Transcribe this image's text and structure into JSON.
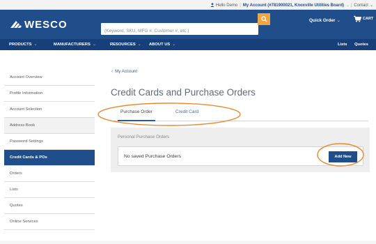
{
  "utility_bar": {
    "hello": "Hello Demo",
    "account": "My Account (#781900021, Knoxville Utilities Board)",
    "contact": "Contact"
  },
  "header": {
    "logo_text": "WESCO",
    "search_placeholder": "(Keyword, SKU, MFG #, Customer #, etc.)",
    "quick_order": "Quick Order",
    "cart": "CART"
  },
  "nav": {
    "products": "PRODUCTS",
    "manufacturers": "MANUFACTURERS",
    "resources": "RESOURCES",
    "about": "ABOUT US",
    "lists": "Lists",
    "quotes": "Quotes"
  },
  "sidebar": {
    "items": [
      {
        "label": "Account Overview"
      },
      {
        "label": "Profile Information"
      },
      {
        "label": "Account Selection"
      },
      {
        "label": "Address Book"
      },
      {
        "label": "Password Settings"
      },
      {
        "label": "Credit Cards & POs"
      },
      {
        "label": "Orders"
      },
      {
        "label": "Lists"
      },
      {
        "label": "Quotes"
      },
      {
        "label": "Online Services"
      }
    ]
  },
  "main": {
    "back_link": "My Account",
    "title": "Credit Cards and Purchase Orders",
    "tabs": [
      {
        "label": "Purchase Order"
      },
      {
        "label": "Credit Card"
      }
    ],
    "panel_title": "Personal Purchase Orders",
    "empty_text": "No saved Purchase Orders",
    "add_button": "Add New"
  },
  "colors": {
    "brand_blue": "#1f4e8a",
    "nav_blue": "#17407a",
    "search_orange": "#f0a540",
    "annotation_orange": "#e98a2e"
  }
}
